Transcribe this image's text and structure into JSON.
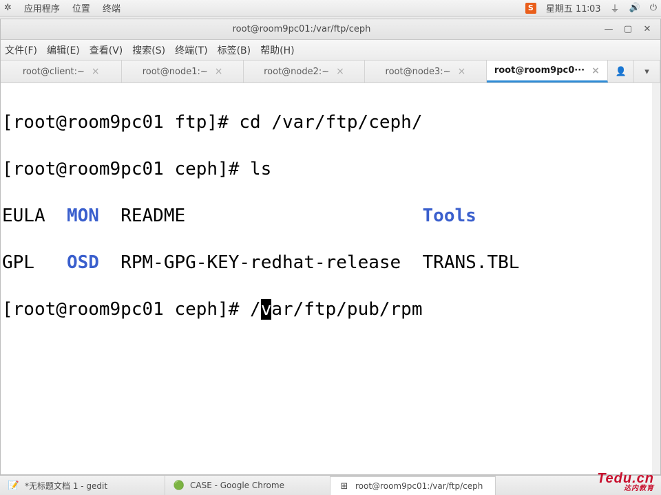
{
  "os_panel": {
    "apps": "应用程序",
    "places": "位置",
    "terminal": "终端",
    "ime_badge": "S",
    "clock": "星期五 11∶03"
  },
  "window": {
    "title": "root@room9pc01:/var/ftp/ceph"
  },
  "menubar": {
    "file": "文件(F)",
    "edit": "编辑(E)",
    "view": "查看(V)",
    "search": "搜索(S)",
    "term": "终端(T)",
    "tabs": "标签(B)",
    "help": "帮助(H)"
  },
  "tabs": [
    {
      "label": "root@client:~"
    },
    {
      "label": "root@node1:~"
    },
    {
      "label": "root@node2:~"
    },
    {
      "label": "root@node3:~"
    },
    {
      "label": "root@room9pc0···",
      "active": true
    }
  ],
  "terminal": {
    "line1_prompt": "[root@room9pc01 ftp]# ",
    "line1_cmd": "cd /var/ftp/ceph/",
    "line2_prompt": "[root@room9pc01 ceph]# ",
    "line2_cmd": "ls",
    "ls_row1_col1": "EULA",
    "ls_row1_col2": "MON",
    "ls_row1_col3": "README",
    "ls_row1_col4": "Tools",
    "ls_row2_col1": "GPL",
    "ls_row2_col2": "OSD",
    "ls_row2_col3": "RPM-GPG-KEY-redhat-release",
    "ls_row2_col4": "TRANS.TBL",
    "line5_prompt": "[root@room9pc01 ceph]# ",
    "line5_pre": "/",
    "line5_cursor": "v",
    "line5_post": "ar/ftp/pub/rpm"
  },
  "taskbar": {
    "gedit": "*无标题文档 1 - gedit",
    "chrome": "CASE - Google Chrome",
    "term": "root@room9pc01:/var/ftp/ceph"
  },
  "brand": {
    "big": "Tedu.cn",
    "small": "达内教育"
  }
}
